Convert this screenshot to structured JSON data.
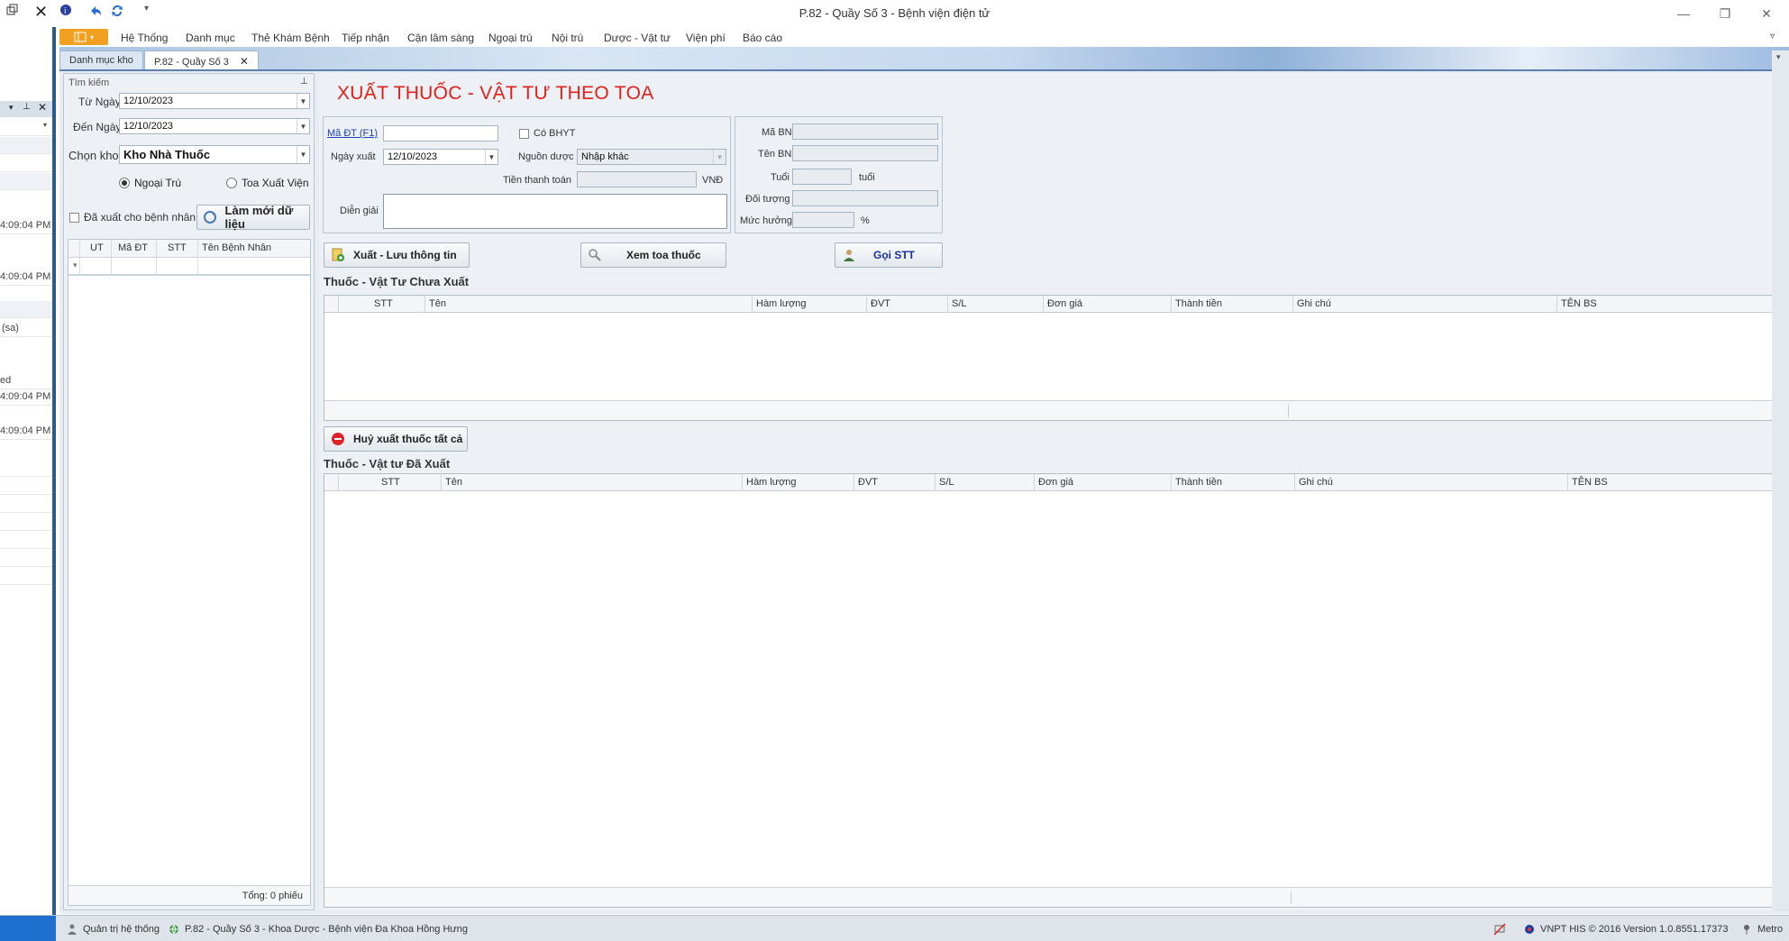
{
  "window": {
    "title": "P.82 - Quầy Số 3 - Bệnh viện điện tử"
  },
  "menu": {
    "items": [
      "Hệ Thống",
      "Danh mục",
      "Thẻ Khám Bệnh",
      "Tiếp nhận",
      "Cận lâm sàng",
      "Ngoại trú",
      "Nội trú",
      "Dược - Vật tư",
      "Viện phí",
      "Báo cáo"
    ]
  },
  "tabs": [
    {
      "label": "Danh mục kho"
    },
    {
      "label": "P.82 - Quầy Số 3"
    }
  ],
  "leftdock": {
    "rows": [
      "4:09:04 PM",
      "4:09:04 PM",
      "(sa)",
      "ed",
      "4:09:04 PM",
      "4:09:04 PM"
    ]
  },
  "search": {
    "panel_title": "Tìm kiếm",
    "from_label": "Từ Ngày",
    "from_value": "12/10/2023",
    "to_label": "Đến Ngày",
    "to_value": "12/10/2023",
    "store_label": "Chọn kho",
    "store_value": "Kho Nhà Thuốc",
    "radio_outpatient": "Ngoại Trú",
    "radio_discharge": "Toa Xuất Viện",
    "dispensed_label": "Đã xuất cho bệnh nhân",
    "refresh_label": "Làm mới dữ liệu",
    "grid_columns": [
      "UT",
      "Mã ĐT",
      "STT",
      "Tên Bệnh Nhân"
    ],
    "total_label": "Tổng: 0 phiếu"
  },
  "form": {
    "title": "XUẤT THUỐC - VẬT TƯ THEO TOA",
    "code_link": "Mã ĐT (F1)",
    "code_value": "",
    "bhyt_label": "Có BHYT",
    "date_label": "Ngày xuất",
    "date_value": "12/10/2023",
    "source_label": "Nguồn dược",
    "source_value": "Nhập khác",
    "payment_label": "Tiền thanh toán",
    "payment_value": "",
    "payment_unit": "VNĐ",
    "note_label": "Diễn giải",
    "note_value": "",
    "patient_id_label": "Mã BN",
    "patient_name_label": "Tên BN",
    "age_label": "Tuổi",
    "age_unit": "tuổi",
    "object_label": "Đối tượng",
    "rate_label": "Mức hưởng",
    "rate_unit": "%"
  },
  "actions": {
    "export_save": "Xuất - Lưu thông tin",
    "view_prescription": "Xem toa thuốc",
    "call_number": "Gọi STT",
    "cancel_all": "Huỷ xuất thuốc tất cả"
  },
  "pending": {
    "title": "Thuốc - Vật Tư Chưa Xuất",
    "columns": [
      "STT",
      "Tên",
      "Hàm lượng",
      "ĐVT",
      "S/L",
      "Đơn giá",
      "Thành tiền",
      "Ghi chú",
      "TÊN BS"
    ]
  },
  "dispensed": {
    "title": "Thuốc - Vật tư Đã Xuất",
    "columns": [
      "STT",
      "Tên",
      "Hàm lượng",
      "ĐVT",
      "S/L",
      "Đơn giá",
      "Thành tiền",
      "Ghi chú",
      "TÊN BS"
    ]
  },
  "status": {
    "user": "Quản trị hệ thống",
    "location": "P.82 - Quầy Số 3 - Khoa Dược - Bệnh viện Đa Khoa Hồng Hưng",
    "version": "VNPT HIS © 2016 Version 1.0.8551.17373",
    "theme": "Metro"
  },
  "colors": {
    "title_red": "#e0201b",
    "app_button": "#f2a020",
    "link_blue": "#1a3fbf",
    "status_blue": "#1f6fcf"
  }
}
